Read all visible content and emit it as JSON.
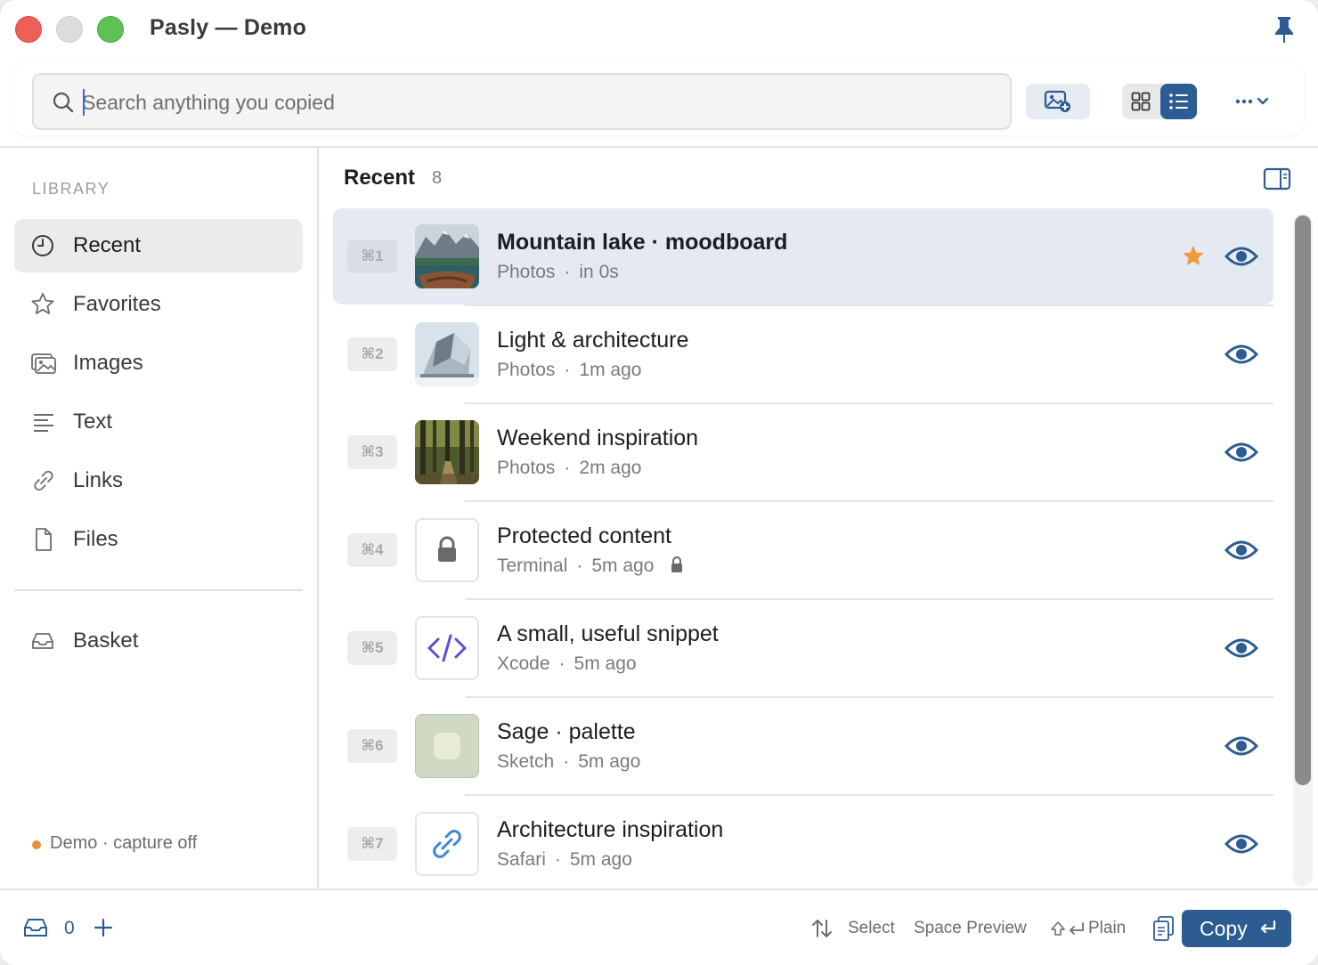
{
  "window": {
    "title": "Pasly — Demo",
    "icons": {
      "pin": "pin-icon"
    }
  },
  "toolbar": {
    "search_placeholder": "Search anything you copied",
    "search_value": "",
    "icons": [
      "search-icon",
      "image-plus-icon",
      "grid-view-icon",
      "list-view-icon",
      "more-icon",
      "chevron-down-icon"
    ],
    "active_view": "list"
  },
  "sidebar": {
    "heading": "LIBRARY",
    "items": [
      {
        "label": "Recent",
        "icon": "clock-icon",
        "active": true
      },
      {
        "label": "Favorites",
        "icon": "star-icon",
        "active": false
      },
      {
        "label": "Images",
        "icon": "images-icon",
        "active": false
      },
      {
        "label": "Text",
        "icon": "text-lines-icon",
        "active": false
      },
      {
        "label": "Links",
        "icon": "link-icon",
        "active": false
      },
      {
        "label": "Files",
        "icon": "file-icon",
        "active": false
      }
    ],
    "basket": {
      "label": "Basket",
      "icon": "tray-icon"
    },
    "status": "Demo · capture off"
  },
  "main": {
    "title": "Recent",
    "count": "8",
    "items": [
      {
        "shortcut": "⌘1",
        "title": "Mountain lake · moodboard",
        "source": "Photos",
        "time": "in 0s",
        "favorite": true,
        "selected": true,
        "thumb": "photo-mountain-lake"
      },
      {
        "shortcut": "⌘2",
        "title": "Light & architecture",
        "source": "Photos",
        "time": "1m ago",
        "favorite": false,
        "selected": false,
        "thumb": "photo-architecture"
      },
      {
        "shortcut": "⌘3",
        "title": "Weekend inspiration",
        "source": "Photos",
        "time": "2m ago",
        "favorite": false,
        "selected": false,
        "thumb": "photo-forest"
      },
      {
        "shortcut": "⌘4",
        "title": "Protected content",
        "source": "Terminal",
        "time": "5m ago",
        "favorite": false,
        "selected": false,
        "thumb": "lock-icon",
        "locked": true
      },
      {
        "shortcut": "⌘5",
        "title": "A small, useful snippet",
        "source": "Xcode",
        "time": "5m ago",
        "favorite": false,
        "selected": false,
        "thumb": "code-icon"
      },
      {
        "shortcut": "⌘6",
        "title": "Sage · palette",
        "source": "Sketch",
        "time": "5m ago",
        "favorite": false,
        "selected": false,
        "thumb": "color-swatch"
      },
      {
        "shortcut": "⌘7",
        "title": "Architecture inspiration",
        "source": "Safari",
        "time": "5m ago",
        "favorite": false,
        "selected": false,
        "thumb": "link-icon"
      }
    ]
  },
  "footer": {
    "basket_count": "0",
    "hints": {
      "select": "Select",
      "preview": "Space Preview",
      "plain": "Plain"
    },
    "copy_label": "Copy"
  },
  "colors": {
    "accent": "#2c5c91",
    "selected_row": "#e5eaf2",
    "favorite_star": "#ef9a3c",
    "status_dot": "#e8913a",
    "code_icon": "#5b4fd6",
    "link_icon": "#3f86d8",
    "swatch_outer": "#cfd9c4",
    "swatch_inner": "#e8ecd6"
  }
}
